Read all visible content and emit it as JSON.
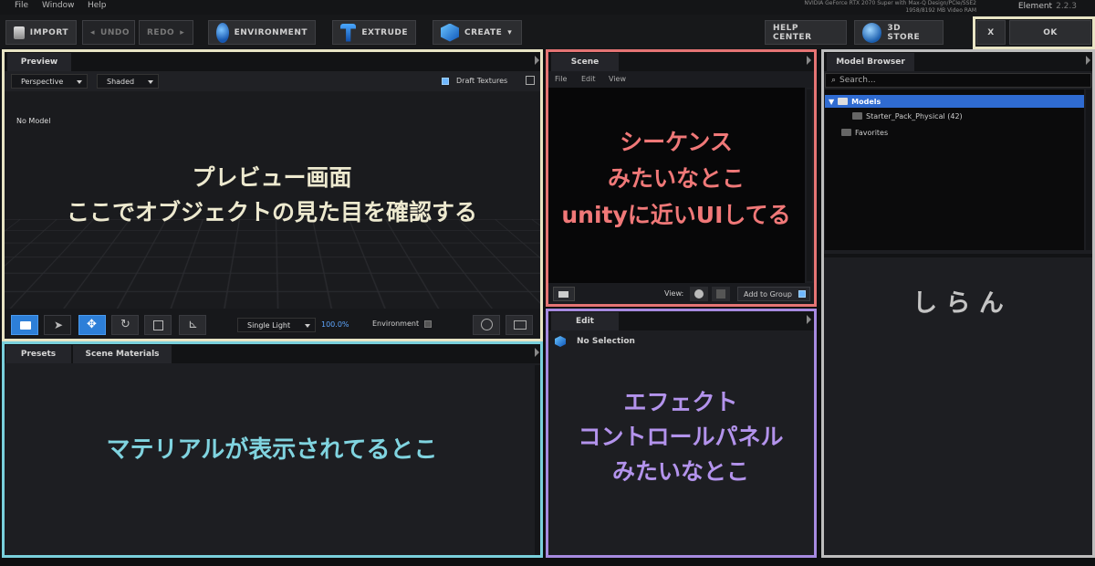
{
  "menubar": {
    "items": [
      "File",
      "Window",
      "Help"
    ],
    "gpu_line1": "NVIDIA GeForce RTX 2070 Super with Max-Q Design/PCIe/SSE2",
    "gpu_line2": "1958/8192 MB Video RAM",
    "app_name": "Element",
    "version": "2.2.3"
  },
  "toolbar": {
    "import": "IMPORT",
    "undo": "UNDO",
    "redo": "REDO",
    "environment": "ENVIRONMENT",
    "extrude": "EXTRUDE",
    "create": "CREATE",
    "help_center": "HELP CENTER",
    "store": "3D STORE",
    "close": "X",
    "ok": "OK"
  },
  "preview": {
    "tab": "Preview",
    "camera": "Perspective",
    "shading": "Shaded",
    "draft_textures": "Draft Textures",
    "no_model": "No Model",
    "light": "Single Light",
    "zoom": "100.0%",
    "environment": "Environment",
    "annotation_line1": "プレビュー画面",
    "annotation_line2": "ここでオブジェクトの見た目を確認する"
  },
  "scene": {
    "tab": "Scene",
    "menu": [
      "File",
      "Edit",
      "View"
    ],
    "view_label": "View:",
    "add_to_group": "Add to Group",
    "annotation_line1": "シーケンス",
    "annotation_line2": "みたいなとこ",
    "annotation_line3": "unityに近いUIしてる"
  },
  "edit": {
    "tab": "Edit",
    "selection": "No Selection",
    "annotation_line1": "エフェクト",
    "annotation_line2": "コントロールパネル",
    "annotation_line3": "みたいなとこ"
  },
  "materials": {
    "tabs": [
      "Presets",
      "Scene Materials"
    ],
    "annotation": "マテリアルが表示されてるとこ"
  },
  "browser": {
    "tab": "Model Browser",
    "search_placeholder": "Search...",
    "tree": [
      {
        "label": "Models"
      },
      {
        "label": "Starter_Pack_Physical (42)"
      },
      {
        "label": "Favorites"
      }
    ],
    "annotation": "し ら ん"
  },
  "colors": {
    "preview_frame": "#e8e4c4",
    "scene_frame": "#e57474",
    "edit_frame": "#a68ae0",
    "materials_frame": "#79d0dc",
    "browser_frame": "#bdbdbd",
    "accent": "#2d7fd8"
  }
}
